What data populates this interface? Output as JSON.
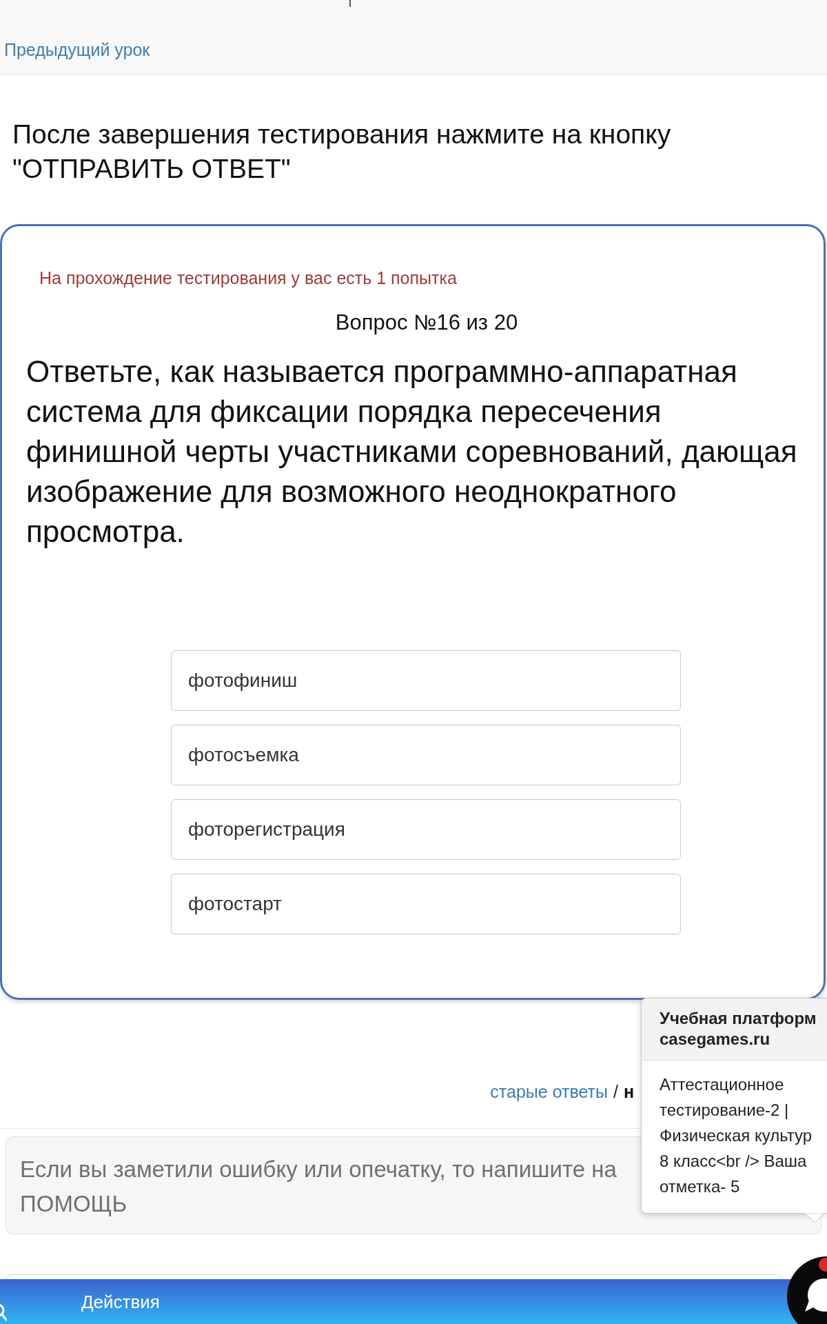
{
  "top_bar": {
    "previous_lesson_link": "Предыдущий урок"
  },
  "instruction": "После завершения тестирования нажмите на кнопку \"ОТПРАВИТЬ ОТВЕТ\"",
  "test_card": {
    "attempts_notice": "На прохождение тестирования у вас есть 1 попытка",
    "question_counter": "Вопрос №16 из 20",
    "question": "Ответьте, как называется программно-аппаратная система для фиксации порядка пересечения финишной черты участниками соревнований, дающая изображение для возможного неоднократного просмотра.",
    "answers": [
      {
        "label": "фотофиниш",
        "selected": false
      },
      {
        "label": "фотосъемка",
        "selected": false
      },
      {
        "label": "фоторегистрация",
        "selected": false
      },
      {
        "label": "фотостарт",
        "selected": false
      }
    ]
  },
  "answer_history": {
    "old_answers_link": "старые ответы",
    "separator": "/",
    "current_view": "н"
  },
  "feedback_field": {
    "placeholder": [
      "Если вы заметили ошибку или опечатку, то напишите на",
      "ПОМОЩЬ"
    ]
  },
  "popover": {
    "title_lines": [
      "Учебная платформ",
      "casegames.ru"
    ],
    "body_lines": [
      "Аттестационное",
      "тестирование-2 |",
      "Физическая культур",
      "8 класс<br /> Ваша",
      "отметка- 5"
    ]
  },
  "bottom_bar": {
    "label": "Действия"
  }
}
